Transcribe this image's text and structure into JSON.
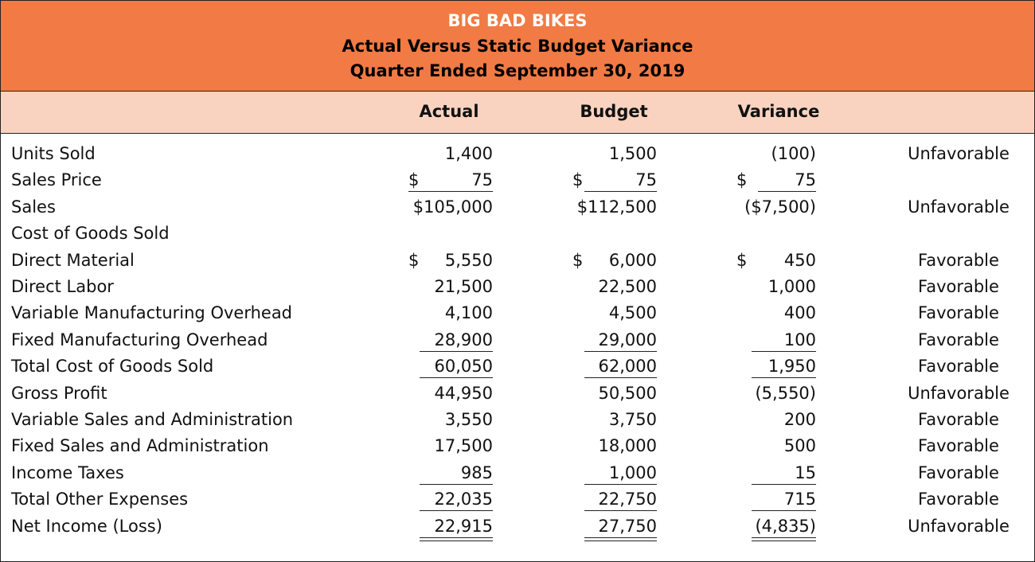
{
  "report": {
    "company": "BIG BAD BIKES",
    "title": "Actual Versus Static Budget Variance",
    "period": "Quarter Ended September 30, 2019"
  },
  "columns": {
    "actual": "Actual",
    "budget": "Budget",
    "variance": "Variance"
  },
  "colors": {
    "title_band": "#f27a44",
    "header_band": "#f9d3c0"
  },
  "rows": [
    {
      "label": "Units Sold",
      "actual": "1,400",
      "budget": "1,500",
      "variance": "(100)",
      "status": "Unfavorable"
    },
    {
      "label": "Sales Price",
      "actual_sym": "$",
      "actual": "75",
      "budget_sym": "$",
      "budget": "75",
      "variance_sym": "$",
      "variance": "75",
      "status": ""
    },
    {
      "label": "Sales",
      "actual": "$105,000",
      "budget": "$112,500",
      "variance": "($7,500)",
      "status": "Unfavorable"
    },
    {
      "label": "Cost of Goods Sold",
      "actual": "",
      "budget": "",
      "variance": "",
      "status": ""
    },
    {
      "label": "Direct Material",
      "actual_sym": "$",
      "actual": "5,550",
      "budget_sym": "$",
      "budget": "6,000",
      "variance_sym": "$",
      "variance": "450",
      "status": "Favorable"
    },
    {
      "label": "Direct Labor",
      "actual": "21,500",
      "budget": "22,500",
      "variance": "1,000",
      "status": "Favorable"
    },
    {
      "label": "Variable Manufacturing Overhead",
      "actual": "4,100",
      "budget": "4,500",
      "variance": "400",
      "status": "Favorable"
    },
    {
      "label": "Fixed Manufacturing Overhead",
      "actual": "28,900",
      "budget": "29,000",
      "variance": "100",
      "status": "Favorable"
    },
    {
      "label": "Total Cost of Goods Sold",
      "actual": "60,050",
      "budget": "62,000",
      "variance": "1,950",
      "status": "Favorable"
    },
    {
      "label": "Gross Profit",
      "actual": "44,950",
      "budget": "50,500",
      "variance": "(5,550)",
      "status": "Unfavorable"
    },
    {
      "label": "Variable Sales and Administration",
      "actual": "3,550",
      "budget": "3,750",
      "variance": "200",
      "status": "Favorable"
    },
    {
      "label": "Fixed Sales and Administration",
      "actual": "17,500",
      "budget": "18,000",
      "variance": "500",
      "status": "Favorable"
    },
    {
      "label": "Income Taxes",
      "actual": "985",
      "budget": "1,000",
      "variance": "15",
      "status": "Favorable"
    },
    {
      "label": "Total Other Expenses",
      "actual": "22,035",
      "budget": "22,750",
      "variance": "715",
      "status": "Favorable"
    },
    {
      "label": "Net Income (Loss)",
      "actual": "22,915",
      "budget": "27,750",
      "variance": "(4,835)",
      "status": "Unfavorable"
    }
  ]
}
